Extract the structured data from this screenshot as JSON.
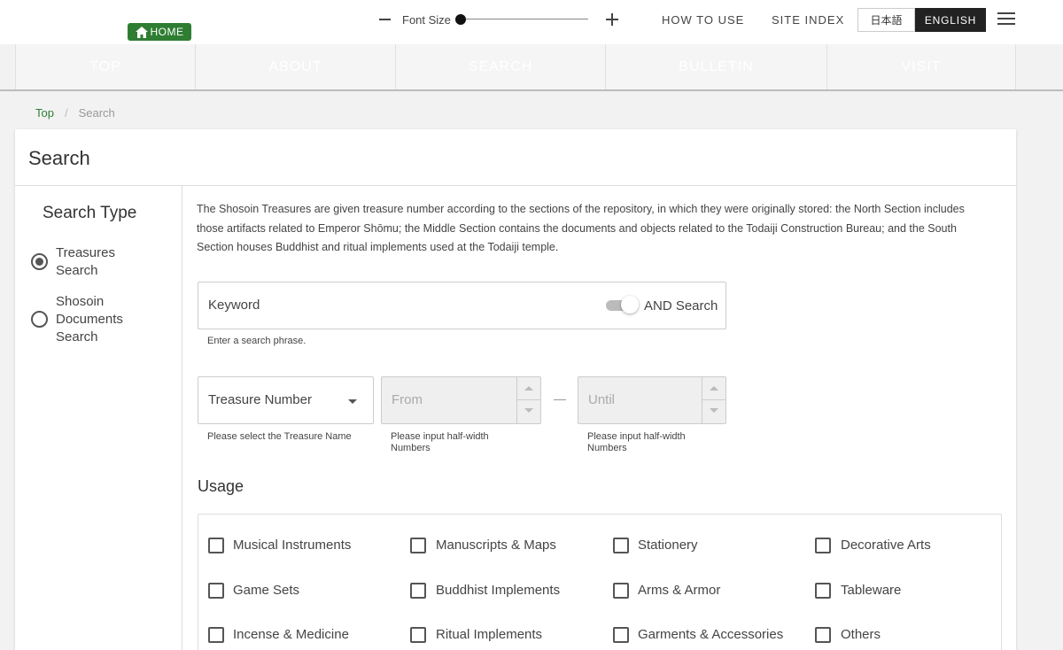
{
  "header": {
    "home_label": "HOME",
    "font_size_label": "Font Size",
    "how_to_use": "HOW TO USE",
    "site_index": "SITE INDEX",
    "lang_ja": "日本語",
    "lang_en": "ENGLISH"
  },
  "nav": [
    "TOP",
    "ABOUT",
    "SEARCH",
    "BULLETIN",
    "VISIT"
  ],
  "breadcrumb": {
    "top": "Top",
    "separator": "/",
    "current": "Search"
  },
  "page": {
    "title": "Search",
    "search_type_title": "Search Type",
    "radio_treasures": "Treasures Search",
    "radio_documents": "Shosoin Documents Search",
    "description": "The Shosoin Treasures are given treasure number according to the sections of the repository, in which they were originally stored: the North Section includes those artifacts related to Emperor Shōmu; the Middle Section contains the documents and objects related to the Todaiji Construction Bureau; and the South Section houses Buddhist and ritual implements used at the Todaiji temple.",
    "keyword_label": "Keyword",
    "and_search_label": "AND Search",
    "keyword_hint": "Enter a search phrase.",
    "treasure_number_label": "Treasure Number",
    "treasure_number_hint": "Please select the Treasure Name",
    "from_placeholder": "From",
    "until_placeholder": "Until",
    "numbers_hint": "Please input half-width Numbers",
    "usage_title": "Usage",
    "usage_items": [
      "Musical Instruments",
      "Manuscripts & Maps",
      "Stationery",
      "Decorative Arts",
      "Game Sets",
      "Buddhist Implements",
      "Arms & Armor",
      "Tableware",
      "Incense & Medicine",
      "Ritual Implements",
      "Garments & Accessories",
      "Others"
    ]
  }
}
